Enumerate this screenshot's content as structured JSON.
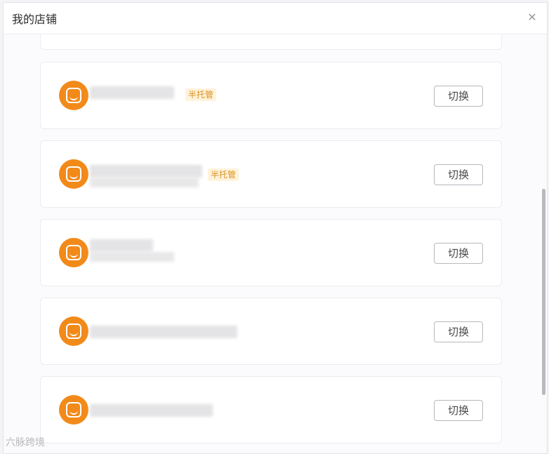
{
  "dialog": {
    "title": "我的店铺",
    "close_icon": "close-icon"
  },
  "stores": [
    {
      "tag": "半托管",
      "switch_label": "切换"
    },
    {
      "tag": "半托管",
      "switch_label": "切换"
    },
    {
      "tag": "",
      "switch_label": "切换"
    },
    {
      "tag": "",
      "switch_label": "切换"
    },
    {
      "tag": "",
      "switch_label": "切换"
    }
  ],
  "watermark": {
    "text": "六脉跨境"
  },
  "colors": {
    "accent": "#f28a1a",
    "tag_bg": "#fff3dc",
    "tag_text": "#d9911f"
  }
}
